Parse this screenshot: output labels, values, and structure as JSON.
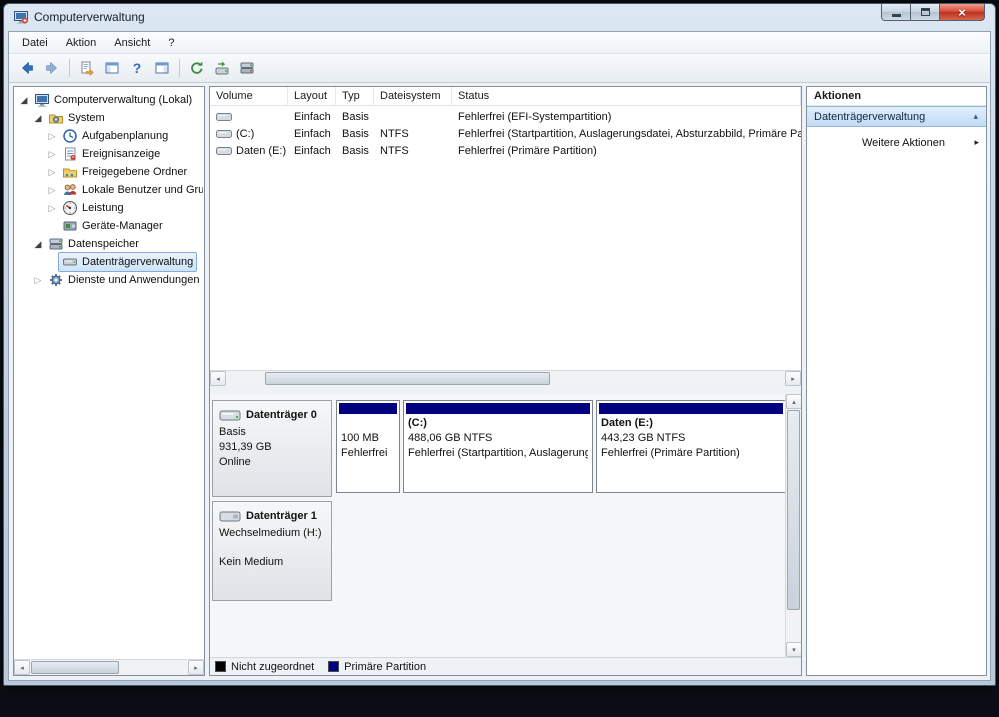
{
  "window": {
    "title": "Computerverwaltung"
  },
  "colors": {
    "primary_partition": "#000080",
    "unallocated": "#000000",
    "selection_blue": "#cde4f7",
    "close_button_red": "#bb3322",
    "titlebar": "#c6d4e2"
  },
  "menu": {
    "items": [
      "Datei",
      "Aktion",
      "Ansicht",
      "?"
    ]
  },
  "toolbar": {
    "icons": [
      "back",
      "forward",
      "export-list",
      "console-tree-toggle",
      "help",
      "action-pane-toggle",
      "refresh",
      "rescan-disks",
      "disk-properties"
    ]
  },
  "tree": {
    "items": [
      {
        "label": "Computerverwaltung (Lokal)",
        "level": 0,
        "state": "expanded",
        "icon": "computer-management"
      },
      {
        "label": "System",
        "level": 1,
        "state": "expanded",
        "icon": "system-tools"
      },
      {
        "label": "Aufgabenplanung",
        "level": 2,
        "state": "collapsed",
        "icon": "task-scheduler"
      },
      {
        "label": "Ereignisanzeige",
        "level": 2,
        "state": "collapsed",
        "icon": "event-viewer"
      },
      {
        "label": "Freigegebene Ordner",
        "level": 2,
        "state": "collapsed",
        "icon": "shared-folders"
      },
      {
        "label": "Lokale Benutzer und Gruppen",
        "level": 2,
        "state": "collapsed",
        "icon": "local-users-groups"
      },
      {
        "label": "Leistung",
        "level": 2,
        "state": "collapsed",
        "icon": "performance"
      },
      {
        "label": "Geräte-Manager",
        "level": 2,
        "state": "none",
        "icon": "device-manager"
      },
      {
        "label": "Datenspeicher",
        "level": 1,
        "state": "expanded",
        "icon": "storage"
      },
      {
        "label": "Datenträgerverwaltung",
        "level": 2,
        "state": "none",
        "icon": "disk-management",
        "selected": true
      },
      {
        "label": "Dienste und Anwendungen",
        "level": 1,
        "state": "collapsed",
        "icon": "services"
      }
    ]
  },
  "volume_table": {
    "columns": [
      "Volume",
      "Layout",
      "Typ",
      "Dateisystem",
      "Status"
    ],
    "rows": [
      {
        "volume": "",
        "layout": "Einfach",
        "typ": "Basis",
        "dateisystem": "",
        "status": "Fehlerfrei (EFI-Systempartition)"
      },
      {
        "volume": "(C:)",
        "layout": "Einfach",
        "typ": "Basis",
        "dateisystem": "NTFS",
        "status": "Fehlerfrei (Startpartition, Auslagerungsdatei, Absturzabbild, Primäre Partition)"
      },
      {
        "volume": "Daten (E:)",
        "layout": "Einfach",
        "typ": "Basis",
        "dateisystem": "NTFS",
        "status": "Fehlerfrei (Primäre Partition)"
      }
    ]
  },
  "disk_view": {
    "disks": [
      {
        "name": "Datenträger 0",
        "lines": [
          "Basis",
          "931,39 GB",
          "Online"
        ],
        "partitions": [
          {
            "name": "",
            "size": "100 MB",
            "status": "Fehlerfrei"
          },
          {
            "name": "(C:)",
            "size": "488,06 GB NTFS",
            "status": "Fehlerfrei (Startpartition, Auslagerungsdatei, Absturzabbild, Primäre Partition)"
          },
          {
            "name": "Daten (E:)",
            "size": "443,23 GB NTFS",
            "status": "Fehlerfrei (Primäre Partition)"
          }
        ]
      },
      {
        "name": "Datenträger 1",
        "lines": [
          "Wechselmedium (H:)",
          "Kein Medium"
        ],
        "partitions": []
      }
    ],
    "legend": [
      {
        "label": "Nicht zugeordnet",
        "color": "#000000"
      },
      {
        "label": "Primäre Partition",
        "color": "#000080"
      }
    ]
  },
  "actions": {
    "header": "Aktionen",
    "items": [
      {
        "label": "Datenträgerverwaltung",
        "selected": true,
        "icon": "collapse-chevron"
      },
      {
        "label": "Weitere Aktionen",
        "icon": "submenu-arrow"
      }
    ]
  }
}
